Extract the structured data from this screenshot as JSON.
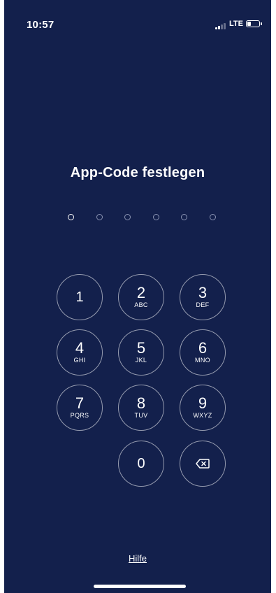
{
  "status_bar": {
    "time": "10:57",
    "network": "LTE",
    "signal_bars_filled": 2,
    "battery_level": 0.35
  },
  "title": "App-Code festlegen",
  "pin": {
    "length": 6,
    "entered": 0
  },
  "keypad": {
    "keys": [
      {
        "digit": "1",
        "letters": ""
      },
      {
        "digit": "2",
        "letters": "ABC"
      },
      {
        "digit": "3",
        "letters": "DEF"
      },
      {
        "digit": "4",
        "letters": "GHI"
      },
      {
        "digit": "5",
        "letters": "JKL"
      },
      {
        "digit": "6",
        "letters": "MNO"
      },
      {
        "digit": "7",
        "letters": "PQRS"
      },
      {
        "digit": "8",
        "letters": "TUV"
      },
      {
        "digit": "9",
        "letters": "WXYZ"
      },
      {
        "digit": "0",
        "letters": ""
      }
    ],
    "delete_icon": "backspace-icon"
  },
  "help_label": "Hilfe",
  "colors": {
    "background": "#13204c",
    "foreground": "#ffffff"
  }
}
